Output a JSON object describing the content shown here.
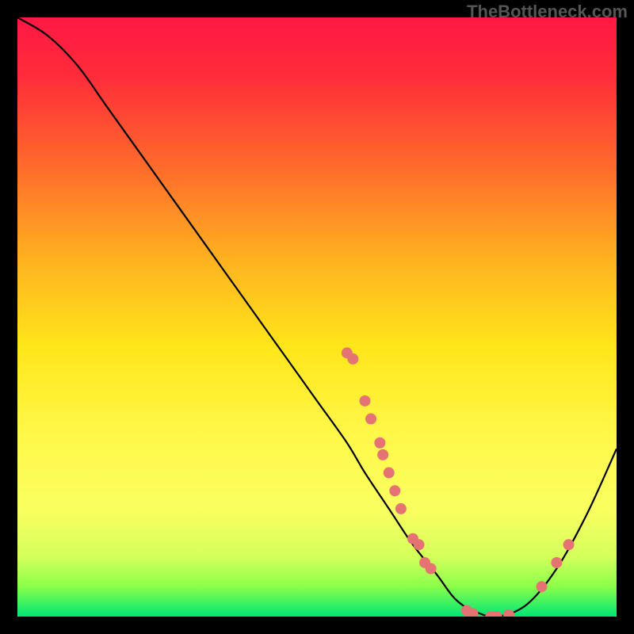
{
  "watermark": "TheBottleneck.com",
  "chart_data": {
    "type": "line",
    "title": "",
    "xlabel": "",
    "ylabel": "",
    "xlim": [
      0,
      100
    ],
    "ylim": [
      0,
      100
    ],
    "gradient_stops": [
      {
        "offset": 0,
        "color": "#ff1744"
      },
      {
        "offset": 10,
        "color": "#ff2d3a"
      },
      {
        "offset": 25,
        "color": "#ff6b2b"
      },
      {
        "offset": 40,
        "color": "#ffb020"
      },
      {
        "offset": 55,
        "color": "#ffe61a"
      },
      {
        "offset": 70,
        "color": "#fff84a"
      },
      {
        "offset": 82,
        "color": "#faff60"
      },
      {
        "offset": 90,
        "color": "#d4ff5a"
      },
      {
        "offset": 95,
        "color": "#8aff4a"
      },
      {
        "offset": 100,
        "color": "#00e676"
      }
    ],
    "series": [
      {
        "name": "bottleneck-curve",
        "color": "#000000",
        "x": [
          0,
          5,
          10,
          15,
          20,
          25,
          30,
          35,
          40,
          45,
          50,
          55,
          58,
          62,
          66,
          70,
          73,
          76,
          80,
          85,
          90,
          95,
          100
        ],
        "y": [
          100,
          97,
          92,
          85,
          78,
          71,
          64,
          57,
          50,
          43,
          36,
          29,
          24,
          18,
          12,
          7,
          3,
          1,
          0,
          2,
          8,
          17,
          28
        ]
      }
    ],
    "scatter_points": [
      {
        "x": 55,
        "y": 44
      },
      {
        "x": 56,
        "y": 43
      },
      {
        "x": 58,
        "y": 36
      },
      {
        "x": 59,
        "y": 33
      },
      {
        "x": 60.5,
        "y": 29
      },
      {
        "x": 61,
        "y": 27
      },
      {
        "x": 62,
        "y": 24
      },
      {
        "x": 63,
        "y": 21
      },
      {
        "x": 64,
        "y": 18
      },
      {
        "x": 66,
        "y": 13
      },
      {
        "x": 67,
        "y": 12
      },
      {
        "x": 68,
        "y": 9
      },
      {
        "x": 69,
        "y": 8
      },
      {
        "x": 75,
        "y": 1
      },
      {
        "x": 76,
        "y": 0.5
      },
      {
        "x": 79,
        "y": 0
      },
      {
        "x": 80,
        "y": 0
      },
      {
        "x": 82,
        "y": 0.3
      },
      {
        "x": 87.5,
        "y": 5
      },
      {
        "x": 90,
        "y": 9
      },
      {
        "x": 92,
        "y": 12
      }
    ],
    "scatter_color": "#e57373",
    "scatter_radius": 7
  }
}
